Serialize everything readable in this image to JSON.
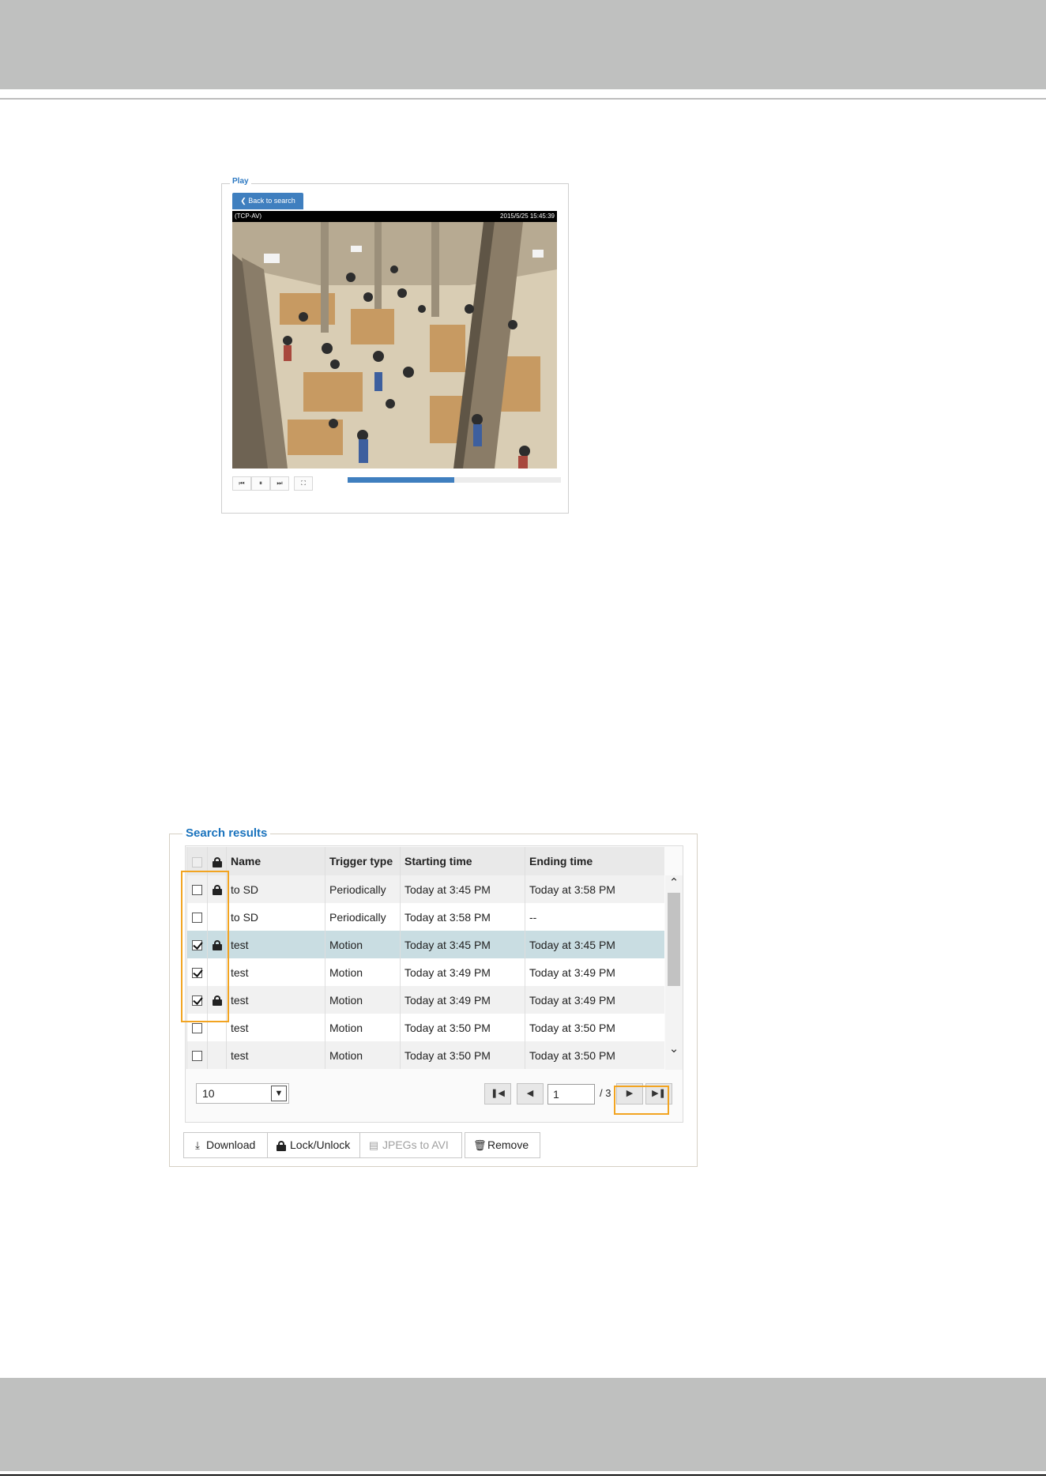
{
  "play": {
    "legend": "Play",
    "back_label": "Back to search",
    "camera_label": "(TCP-AV)",
    "timestamp": "2015/5/25 15:45:39",
    "controls": [
      {
        "name": "previous-icon",
        "glyph": "⏮"
      },
      {
        "name": "pause-icon",
        "glyph": "⏸"
      },
      {
        "name": "next-icon",
        "glyph": "⏭"
      },
      {
        "name": "fullscreen-icon",
        "glyph": "⛶"
      }
    ],
    "progress": 0.5
  },
  "search_results": {
    "legend": "Search results",
    "columns": {
      "name": "Name",
      "trigger": "Trigger type",
      "start": "Starting time",
      "end": "Ending time"
    },
    "rows": [
      {
        "checked": false,
        "locked": true,
        "name": "to SD",
        "trigger": "Periodically",
        "start": "Today at 3:45 PM",
        "end": "Today at 3:58 PM"
      },
      {
        "checked": false,
        "locked": false,
        "name": "to SD",
        "trigger": "Periodically",
        "start": "Today at 3:58 PM",
        "end": "--"
      },
      {
        "checked": true,
        "locked": true,
        "name": "test",
        "trigger": "Motion",
        "start": "Today at 3:45 PM",
        "end": "Today at 3:45 PM"
      },
      {
        "checked": true,
        "locked": false,
        "name": "test",
        "trigger": "Motion",
        "start": "Today at 3:49 PM",
        "end": "Today at 3:49 PM"
      },
      {
        "checked": true,
        "locked": true,
        "name": "test",
        "trigger": "Motion",
        "start": "Today at 3:49 PM",
        "end": "Today at 3:49 PM"
      },
      {
        "checked": false,
        "locked": false,
        "name": "test",
        "trigger": "Motion",
        "start": "Today at 3:50 PM",
        "end": "Today at 3:50 PM"
      },
      {
        "checked": false,
        "locked": false,
        "name": "test",
        "trigger": "Motion",
        "start": "Today at 3:50 PM",
        "end": "Today at 3:50 PM"
      }
    ],
    "highlighted_row": 2,
    "per_page": "10",
    "page": "1",
    "total_pages": "/ 3",
    "actions": {
      "download": "Download",
      "lock_unlock": "Lock/Unlock",
      "jpegs_to_avi": "JPEGs to AVI",
      "remove": "Remove"
    }
  },
  "colors": {
    "accent": "#1a73bd",
    "highlight_row": "#c9dde2",
    "annotation": "#f2a421",
    "band": "#bfc0bf"
  }
}
